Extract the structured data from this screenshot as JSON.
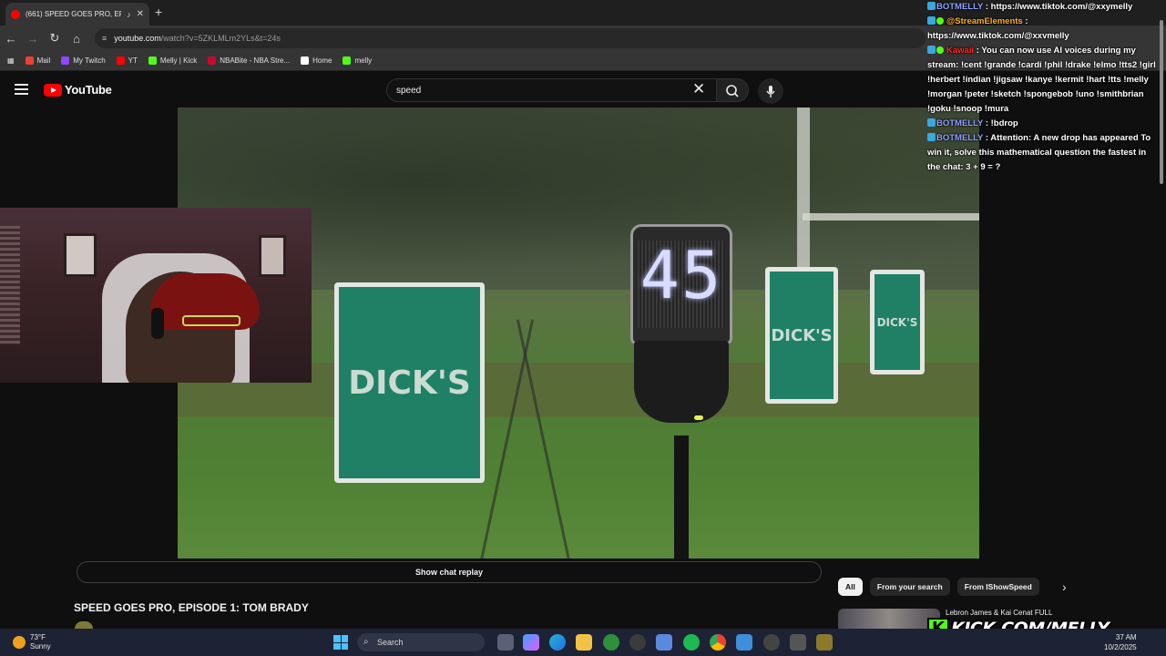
{
  "browser": {
    "tab_title": "(661) SPEED GOES PRO, EP",
    "url_host": "youtube.com",
    "url_path": "/watch?v=5ZKLMLm2YLs&t=24s",
    "bookmarks": [
      {
        "label": "Mail",
        "color": "#ea4335"
      },
      {
        "label": "My Twitch",
        "color": "#9146ff"
      },
      {
        "label": "YT",
        "color": "#ff0000"
      },
      {
        "label": "Melly | Kick",
        "color": "#53fc18"
      },
      {
        "label": "NBABite - NBA Stre...",
        "color": "#c9082a"
      },
      {
        "label": "Home",
        "color": "#ffffff"
      },
      {
        "label": "melly",
        "color": "#53fc18"
      }
    ]
  },
  "youtube": {
    "logo_text": "YouTube",
    "search_value": "speed",
    "show_chat_replay": "Show chat replay",
    "video_title": "SPEED GOES PRO, EPISODE 1: TOM BRADY",
    "chips": [
      "All",
      "From your search",
      "From IShowSpeed"
    ],
    "related_title": "Lebron James & Kai Cenat FULL"
  },
  "video_scene": {
    "display_number": "45",
    "sign_text": "DICK'S"
  },
  "chat": {
    "messages": [
      {
        "user": "BOTMELLY",
        "text": ": https://www.tiktok.com/@xxymelly",
        "user_color": "#8ea0ff"
      },
      {
        "user": "@StreamElements",
        "text": ": https://www.tiktok.com/@xxvmelly",
        "user_color": "#ffb020"
      },
      {
        "user": "Kawaii",
        "text": ": You can now use AI voices during my stream: !cent !grande !cardi !phil !drake !elmo !tts2 !girl !herbert !indian !jigsaw !kanye !kermit !hart !tts !melly !morgan !peter !sketch !spongebob !uno !smithbrian !goku !snoop !mura",
        "user_color": "#ff2a2a"
      },
      {
        "user": "BOTMELLY",
        "text": ": !bdrop",
        "user_color": "#8ea0ff"
      },
      {
        "user": "BOTMELLY",
        "text": ": Attention: A new drop has appeared To win it, solve this mathematical question the fastest in the chat: 3 + 9 = ?",
        "user_color": "#8ea0ff"
      }
    ]
  },
  "watermark": {
    "k": "K",
    "text": "KICK.COM/MELLY"
  },
  "taskbar": {
    "temp": "73°F",
    "condition": "Sunny",
    "search_label": "Search",
    "time": "37 AM",
    "date": "10/2/2025"
  }
}
